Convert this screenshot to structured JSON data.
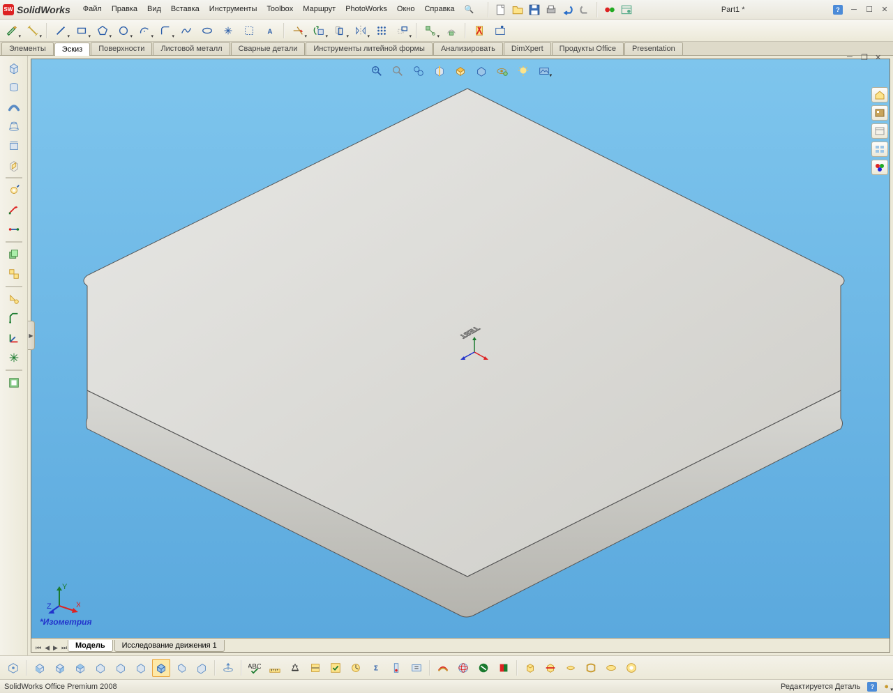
{
  "app": {
    "title": "SolidWorks",
    "doc": "Part1 *"
  },
  "menu": [
    "Файл",
    "Правка",
    "Вид",
    "Вставка",
    "Инструменты",
    "Toolbox",
    "Маршрут",
    "PhotoWorks",
    "Окно",
    "Справка"
  ],
  "tabs": [
    "Элементы",
    "Эскиз",
    "Поверхности",
    "Листовой металл",
    "Сварные детали",
    "Инструменты литейной формы",
    "Анализировать",
    "DimXpert",
    "Продукты Office",
    "Presentation"
  ],
  "active_tab": 1,
  "viewport": {
    "view_label": "*Изометрия",
    "engraved_text": "TEST"
  },
  "bottom_tabs": [
    "Модель",
    "Исследование движения 1"
  ],
  "active_bottom_tab": 0,
  "status": {
    "left": "SolidWorks Office Premium 2008",
    "right": "Редактируется Деталь"
  }
}
